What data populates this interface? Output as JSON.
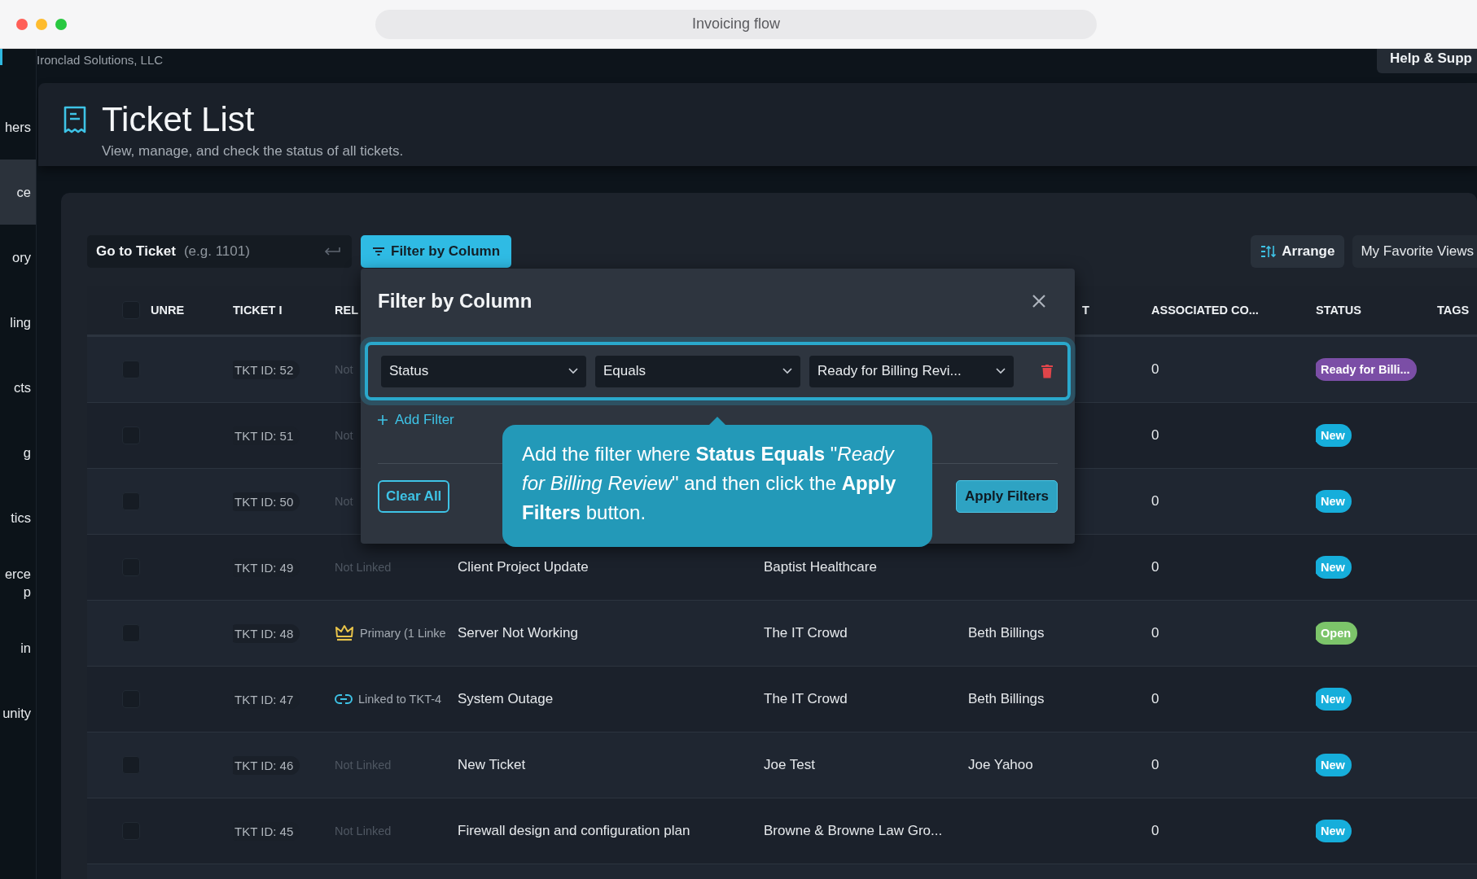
{
  "browser": {
    "address": "Invoicing flow"
  },
  "top_bar": {
    "company": "Ironclad Solutions, LLC",
    "help_button": "Help & Supp"
  },
  "sidebar": {
    "items": [
      {
        "lines": [
          "hers"
        ],
        "selected": false
      },
      {
        "lines": [
          "ce"
        ],
        "selected": true
      },
      {
        "lines": [
          "ory"
        ],
        "selected": false
      },
      {
        "lines": [
          "ling"
        ],
        "selected": false
      },
      {
        "lines": [
          "cts"
        ],
        "selected": false
      },
      {
        "lines": [
          "g"
        ],
        "selected": false
      },
      {
        "lines": [
          "tics"
        ],
        "selected": false
      },
      {
        "lines": [
          "erce",
          "p"
        ],
        "selected": false
      },
      {
        "lines": [
          "in"
        ],
        "selected": false
      },
      {
        "lines": [
          "unity"
        ],
        "selected": false
      }
    ]
  },
  "header": {
    "title": "Ticket List",
    "subtitle": "View, manage, and check the status of all tickets."
  },
  "toolbar": {
    "go_to_ticket": {
      "label": "Go to Ticket",
      "placeholder": "(e.g. 1101)"
    },
    "filter_button": "Filter by Column",
    "arrange_button": "Arrange",
    "views_button": "My Favorite Views"
  },
  "table": {
    "select_all_checked": false,
    "columns": [
      "UNRE",
      "TICKET I",
      "REL",
      null,
      null,
      "T",
      "ASSOCIATED CO...",
      "STATUS",
      "TAGS"
    ],
    "rows": [
      {
        "checked": false,
        "ticket_id": "TKT ID: 52",
        "relation": {
          "kind": "none",
          "text": "Not"
        },
        "associated": "0",
        "status": {
          "label": "Ready for Billi...",
          "color": "#7b4ea6"
        }
      },
      {
        "checked": false,
        "ticket_id": "TKT ID: 51",
        "relation": {
          "kind": "none",
          "text": "Not"
        },
        "associated": "0",
        "status": {
          "label": "New",
          "color": "#16aedb"
        }
      },
      {
        "checked": false,
        "ticket_id": "TKT ID: 50",
        "relation": {
          "kind": "none",
          "text": "Not"
        },
        "associated": "0",
        "status": {
          "label": "New",
          "color": "#16aedb"
        }
      },
      {
        "checked": false,
        "ticket_id": "TKT ID: 49",
        "relation": {
          "kind": "none",
          "text": "Not Linked"
        },
        "subject": "Client Project Update",
        "company": "Baptist Healthcare",
        "associated": "0",
        "status": {
          "label": "New",
          "color": "#16aedb"
        }
      },
      {
        "checked": false,
        "ticket_id": "TKT ID: 48",
        "relation": {
          "kind": "primary",
          "text": "Primary (1 Linke"
        },
        "subject": "Server Not Working",
        "company": "The IT Crowd",
        "contact": "Beth Billings",
        "associated": "0",
        "status": {
          "label": "Open",
          "color": "#7cc46a"
        }
      },
      {
        "checked": false,
        "ticket_id": "TKT ID: 47",
        "relation": {
          "kind": "linked",
          "text": "Linked to TKT-4"
        },
        "subject": "System Outage",
        "company": "The IT Crowd",
        "contact": "Beth Billings",
        "associated": "0",
        "status": {
          "label": "New",
          "color": "#16aedb"
        }
      },
      {
        "checked": false,
        "ticket_id": "TKT ID: 46",
        "relation": {
          "kind": "none",
          "text": "Not Linked"
        },
        "subject": "New Ticket",
        "company": "Joe Test",
        "contact": "Joe Yahoo",
        "associated": "0",
        "status": {
          "label": "New",
          "color": "#16aedb"
        }
      },
      {
        "checked": false,
        "ticket_id": "TKT ID: 45",
        "relation": {
          "kind": "none",
          "text": "Not Linked"
        },
        "subject": "Firewall design and configuration plan",
        "company": "Browne & Browne Law Gro...",
        "associated": "0",
        "status": {
          "label": "New",
          "color": "#16aedb"
        }
      }
    ]
  },
  "filter_dialog": {
    "title": "Filter by Column",
    "filters": [
      {
        "column": "Status",
        "operator": "Equals",
        "value": "Ready for Billing Revi...",
        "highlighted": true
      }
    ],
    "add_filter": "Add Filter",
    "clear_button": "Clear All",
    "apply_button": "Apply Filters"
  },
  "tooltip": {
    "text": "Add the filter where **Status Equals** \"*Ready for Billing Review*\" and then click the **Apply Filters** button."
  }
}
